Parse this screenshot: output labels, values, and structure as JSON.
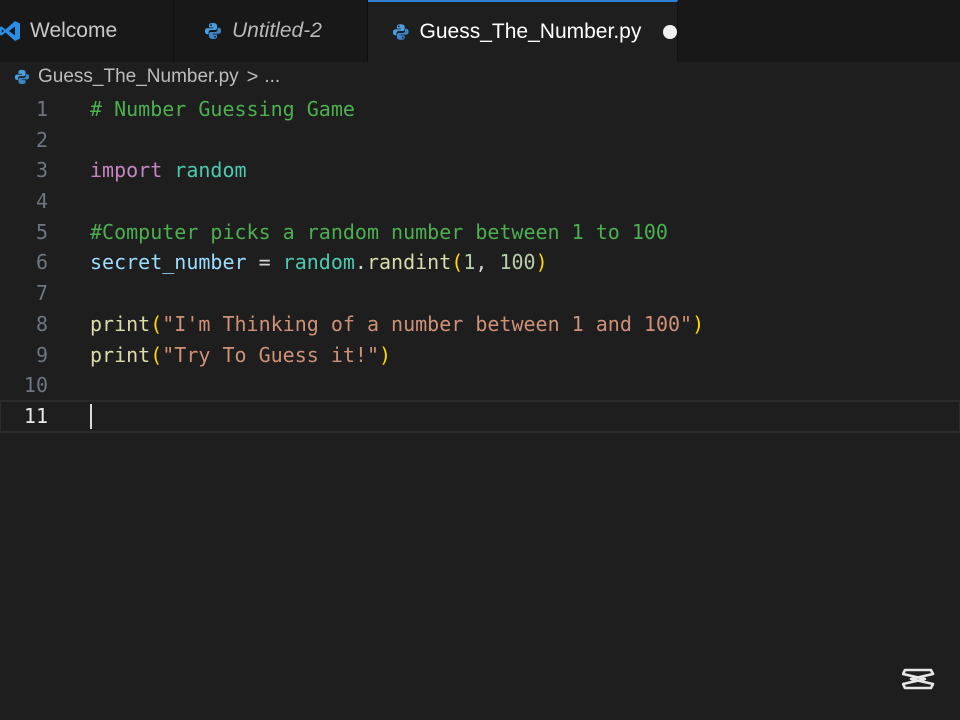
{
  "tabs": [
    {
      "label": "Welcome",
      "icon": "vscode-icon",
      "active": false,
      "italic": false
    },
    {
      "label": "Untitled-2",
      "icon": "python-icon",
      "active": false,
      "italic": true
    },
    {
      "label": "Guess_The_Number.py",
      "icon": "python-icon",
      "active": true,
      "dirty": true
    }
  ],
  "breadcrumb": {
    "file": "Guess_The_Number.py",
    "separator": ">",
    "more": "..."
  },
  "editor": {
    "current_line": 11,
    "lines": [
      {
        "number": "1",
        "tokens": [
          {
            "t": "comment",
            "v": "# Number Guessing Game"
          }
        ]
      },
      {
        "number": "2",
        "tokens": []
      },
      {
        "number": "3",
        "tokens": [
          {
            "t": "keyword",
            "v": "import"
          },
          {
            "t": "plain",
            "v": " "
          },
          {
            "t": "module",
            "v": "random"
          }
        ]
      },
      {
        "number": "4",
        "tokens": []
      },
      {
        "number": "5",
        "tokens": [
          {
            "t": "comment",
            "v": "#Computer picks a random number between 1 to 100"
          }
        ]
      },
      {
        "number": "6",
        "tokens": [
          {
            "t": "var",
            "v": "secret_number"
          },
          {
            "t": "op",
            "v": " = "
          },
          {
            "t": "module",
            "v": "random"
          },
          {
            "t": "op",
            "v": "."
          },
          {
            "t": "func",
            "v": "randint"
          },
          {
            "t": "paren",
            "v": "("
          },
          {
            "t": "num",
            "v": "1"
          },
          {
            "t": "op",
            "v": ", "
          },
          {
            "t": "num",
            "v": "100"
          },
          {
            "t": "paren",
            "v": ")"
          }
        ]
      },
      {
        "number": "7",
        "tokens": []
      },
      {
        "number": "8",
        "tokens": [
          {
            "t": "func",
            "v": "print"
          },
          {
            "t": "paren",
            "v": "("
          },
          {
            "t": "string",
            "v": "\"I'm Thinking of a number between 1 and 100\""
          },
          {
            "t": "paren",
            "v": ")"
          }
        ]
      },
      {
        "number": "9",
        "tokens": [
          {
            "t": "func",
            "v": "print"
          },
          {
            "t": "paren",
            "v": "("
          },
          {
            "t": "string",
            "v": "\"Try To Guess it!\""
          },
          {
            "t": "paren",
            "v": ")"
          }
        ]
      },
      {
        "number": "10",
        "tokens": []
      },
      {
        "number": "11",
        "tokens": []
      }
    ]
  },
  "colors": {
    "background": "#1e1e1e",
    "tab_active_border": "#2f7fd7",
    "comment": "#4caf50",
    "keyword": "#c586c0",
    "module": "#4ec9b0",
    "string": "#ce9178"
  },
  "watermark": {
    "icon": "capcut-logo-icon"
  }
}
